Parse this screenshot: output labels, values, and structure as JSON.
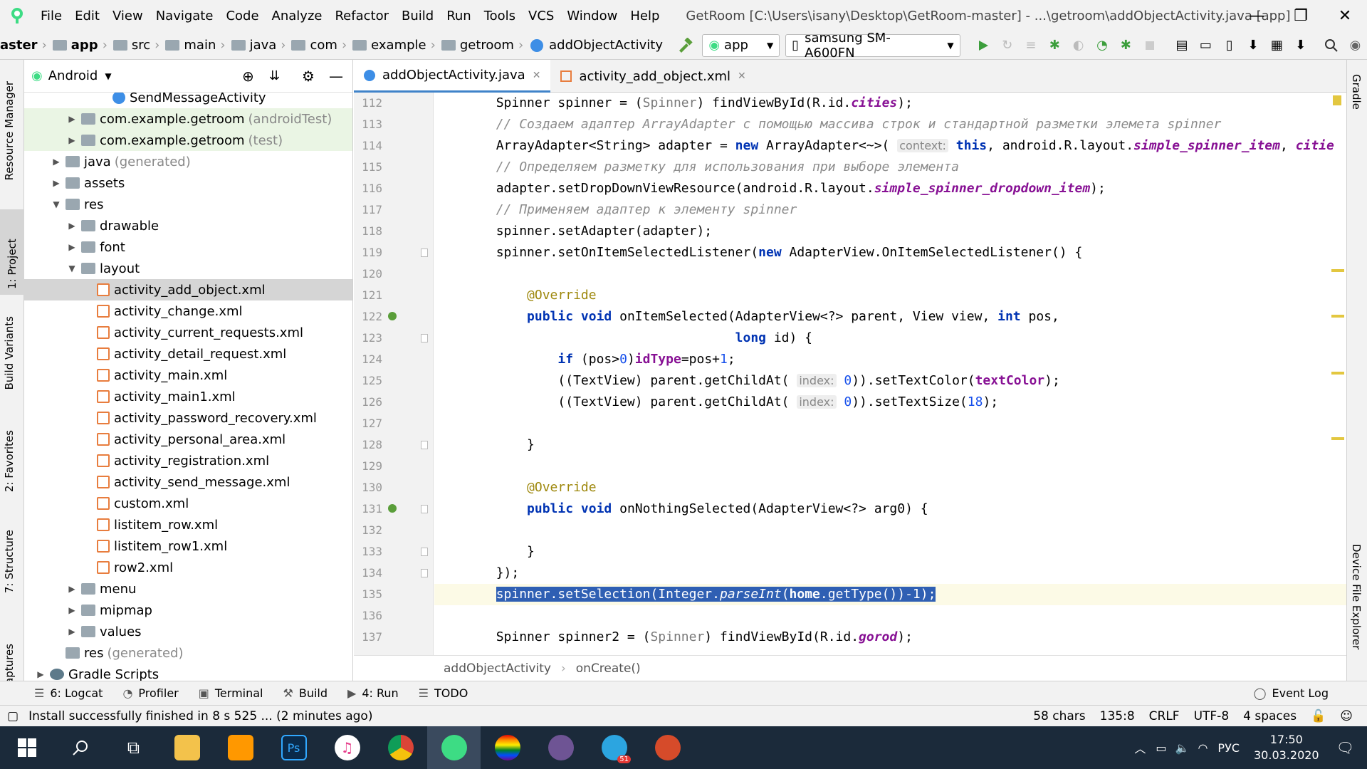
{
  "menubar": {
    "items": [
      "File",
      "Edit",
      "View",
      "Navigate",
      "Code",
      "Analyze",
      "Refactor",
      "Build",
      "Run",
      "Tools",
      "VCS",
      "Window",
      "Help"
    ],
    "title": "GetRoom [C:\\Users\\isany\\Desktop\\GetRoom-master] - ...\\getroom\\addObjectActivity.java [app]"
  },
  "navbar": {
    "crumbs": [
      "aster",
      "app",
      "src",
      "main",
      "java",
      "com",
      "example",
      "getroom",
      "addObjectActivity"
    ],
    "run_config": "app",
    "device": "samsung SM-A600FN"
  },
  "left_strip": {
    "tabs": [
      "Resource Manager",
      "1: Project",
      "Build Variants",
      "2: Favorites",
      "7: Structure",
      "aptures"
    ]
  },
  "project": {
    "view_label": "Android",
    "tree": [
      {
        "label": "SendMessageActivity",
        "suffix": "",
        "indent": 4,
        "icon": "cls",
        "arrow": ""
      },
      {
        "label": "com.example.getroom",
        "suffix": "(androidTest)",
        "indent": 2,
        "icon": "folder",
        "arrow": "▶"
      },
      {
        "label": "com.example.getroom",
        "suffix": "(test)",
        "indent": 2,
        "icon": "folder",
        "arrow": "▶"
      },
      {
        "label": "java",
        "suffix": "(generated)",
        "indent": 1,
        "icon": "folder",
        "arrow": "▶"
      },
      {
        "label": "assets",
        "suffix": "",
        "indent": 1,
        "icon": "folder",
        "arrow": "▶"
      },
      {
        "label": "res",
        "suffix": "",
        "indent": 1,
        "icon": "folder",
        "arrow": "▼"
      },
      {
        "label": "drawable",
        "suffix": "",
        "indent": 2,
        "icon": "folder",
        "arrow": "▶"
      },
      {
        "label": "font",
        "suffix": "",
        "indent": 2,
        "icon": "folder",
        "arrow": "▶"
      },
      {
        "label": "layout",
        "suffix": "",
        "indent": 2,
        "icon": "folder",
        "arrow": "▼"
      },
      {
        "label": "activity_add_object.xml",
        "suffix": "",
        "indent": 3,
        "icon": "xml",
        "arrow": ""
      },
      {
        "label": "activity_change.xml",
        "suffix": "",
        "indent": 3,
        "icon": "xml",
        "arrow": ""
      },
      {
        "label": "activity_current_requests.xml",
        "suffix": "",
        "indent": 3,
        "icon": "xml",
        "arrow": ""
      },
      {
        "label": "activity_detail_request.xml",
        "suffix": "",
        "indent": 3,
        "icon": "xml",
        "arrow": ""
      },
      {
        "label": "activity_main.xml",
        "suffix": "",
        "indent": 3,
        "icon": "xml",
        "arrow": ""
      },
      {
        "label": "activity_main1.xml",
        "suffix": "",
        "indent": 3,
        "icon": "xml",
        "arrow": ""
      },
      {
        "label": "activity_password_recovery.xml",
        "suffix": "",
        "indent": 3,
        "icon": "xml",
        "arrow": ""
      },
      {
        "label": "activity_personal_area.xml",
        "suffix": "",
        "indent": 3,
        "icon": "xml",
        "arrow": ""
      },
      {
        "label": "activity_registration.xml",
        "suffix": "",
        "indent": 3,
        "icon": "xml",
        "arrow": ""
      },
      {
        "label": "activity_send_message.xml",
        "suffix": "",
        "indent": 3,
        "icon": "xml",
        "arrow": ""
      },
      {
        "label": "custom.xml",
        "suffix": "",
        "indent": 3,
        "icon": "xml",
        "arrow": ""
      },
      {
        "label": "listitem_row.xml",
        "suffix": "",
        "indent": 3,
        "icon": "xml",
        "arrow": ""
      },
      {
        "label": "listitem_row1.xml",
        "suffix": "",
        "indent": 3,
        "icon": "xml",
        "arrow": ""
      },
      {
        "label": "row2.xml",
        "suffix": "",
        "indent": 3,
        "icon": "xml",
        "arrow": ""
      },
      {
        "label": "menu",
        "suffix": "",
        "indent": 2,
        "icon": "folder",
        "arrow": "▶"
      },
      {
        "label": "mipmap",
        "suffix": "",
        "indent": 2,
        "icon": "folder",
        "arrow": "▶"
      },
      {
        "label": "values",
        "suffix": "",
        "indent": 2,
        "icon": "folder",
        "arrow": "▶"
      },
      {
        "label": "res",
        "suffix": "(generated)",
        "indent": 1,
        "icon": "folder",
        "arrow": ""
      },
      {
        "label": "Gradle Scripts",
        "suffix": "",
        "indent": 0,
        "icon": "gradle",
        "arrow": "▶"
      }
    ]
  },
  "editor": {
    "tabs": [
      {
        "label": "addObjectActivity.java",
        "active": true
      },
      {
        "label": "activity_add_object.xml",
        "active": false
      }
    ],
    "lines": [
      {
        "n": "112",
        "html": "        Spinner spinner = (<span class=\"cast\">Spinner</span>) findViewById(R.id.<span class=\"fld\">cities</span>);"
      },
      {
        "n": "113",
        "html": "        <span class=\"cm\">// Создаем адаптер ArrayAdapter с помощью массива строк и стандартной разметки элемета spinner</span>"
      },
      {
        "n": "114",
        "html": "        ArrayAdapter&lt;String&gt; adapter = <span class=\"kw\">new</span> ArrayAdapter&lt;~&gt;( <span class=\"hint\">context:</span> <span class=\"kw\">this</span>, android.R.layout.<span class=\"fld\">simple_spinner_item</span>, <span class=\"fld\">citie</span>"
      },
      {
        "n": "115",
        "html": "        <span class=\"cm\">// Определяем разметку для использования при выборе элемента</span>"
      },
      {
        "n": "116",
        "html": "        adapter.setDropDownViewResource(android.R.layout.<span class=\"fld\">simple_spinner_dropdown_item</span>);"
      },
      {
        "n": "117",
        "html": "        <span class=\"cm\">// Применяем адаптер к элементу spinner</span>"
      },
      {
        "n": "118",
        "html": "        spinner.setAdapter(adapter);"
      },
      {
        "n": "119",
        "html": "        spinner.setOnItemSelectedListener(<span class=\"kw\">new</span> AdapterView.OnItemSelectedListener() {"
      },
      {
        "n": "120",
        "html": ""
      },
      {
        "n": "121",
        "html": "            <span class=\"ann\">@Override</span>"
      },
      {
        "n": "122",
        "html": "            <span class=\"kw\">public void</span> onItemSelected(AdapterView&lt;?&gt; parent, View view, <span class=\"kw\">int</span> pos,"
      },
      {
        "n": "123",
        "html": "                                       <span class=\"kw\">long</span> id) {"
      },
      {
        "n": "124",
        "html": "                <span class=\"kw\">if</span> (pos&gt;<span class=\"num\">0</span>)<span class=\"fld\" style=\"font-style:normal\">idType</span>=pos+<span class=\"num\">1</span>;"
      },
      {
        "n": "125",
        "html": "                ((TextView) parent.getChildAt( <span class=\"hint\">index:</span> <span class=\"num\">0</span>)).setTextColor(<span class=\"fld\" style=\"font-style:normal\">textColor</span>);"
      },
      {
        "n": "126",
        "html": "                ((TextView) parent.getChildAt( <span class=\"hint\">index:</span> <span class=\"num\">0</span>)).setTextSize(<span class=\"num\">18</span>);"
      },
      {
        "n": "127",
        "html": ""
      },
      {
        "n": "128",
        "html": "            }"
      },
      {
        "n": "129",
        "html": ""
      },
      {
        "n": "130",
        "html": "            <span class=\"ann\">@Override</span>"
      },
      {
        "n": "131",
        "html": "            <span class=\"kw\">public void</span> onNothingSelected(AdapterView&lt;?&gt; arg0) {"
      },
      {
        "n": "132",
        "html": ""
      },
      {
        "n": "133",
        "html": "            }"
      },
      {
        "n": "134",
        "html": "        });"
      },
      {
        "n": "135",
        "html": "        <span class=\"sel\">spinner.setSelection(Integer.<i>parseInt</i>(<span class=\"kw\" style=\"font-weight:bold\">home</span>.getType())-1);</span>"
      },
      {
        "n": "136",
        "html": ""
      },
      {
        "n": "137",
        "html": "        Spinner spinner2 = (<span class=\"cast\">Spinner</span>) findViewById(R.id.<span class=\"fld\">gorod</span>);"
      }
    ],
    "breadcrumb": [
      "addObjectActivity",
      "onCreate()"
    ]
  },
  "tool_windows": [
    {
      "icon": "☰",
      "label": "6: Logcat"
    },
    {
      "icon": "◔",
      "label": "Profiler"
    },
    {
      "icon": "▣",
      "label": "Terminal"
    },
    {
      "icon": "⚒",
      "label": "Build"
    },
    {
      "icon": "▶",
      "label": "4: Run"
    },
    {
      "icon": "☰",
      "label": "TODO"
    }
  ],
  "event_log": "Event Log",
  "status": {
    "message": "Install successfully finished in 8 s 525 ... (2 minutes ago)",
    "chars": "58 chars",
    "position": "135:8",
    "line_sep": "CRLF",
    "encoding": "UTF-8",
    "indent": "4 spaces"
  },
  "right_strip": {
    "top": "Gradle",
    "bottom": "Device File Explorer"
  },
  "taskbar": {
    "lang": "РУС",
    "time": "17:50",
    "date": "30.03.2020",
    "telegram_badge": "51"
  }
}
